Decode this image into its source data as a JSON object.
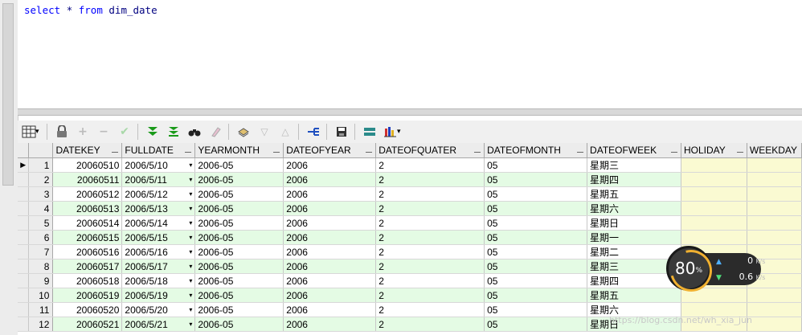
{
  "editor": {
    "sql_keyword_select": "select",
    "sql_star": "*",
    "sql_keyword_from": "from",
    "sql_table": "dim_date"
  },
  "toolbar": {
    "icons": [
      "grid-view-icon",
      "lock-icon",
      "add-record-icon",
      "delete-record-icon",
      "post-changes-icon",
      "fetch-next-icon",
      "fetch-last-icon",
      "query-by-example-icon",
      "clear-icon",
      "export-icon",
      "sort-desc-icon",
      "sort-asc-icon",
      "explain-plan-icon",
      "save-icon",
      "bind-variables-icon",
      "chart-icon"
    ]
  },
  "grid": {
    "columns": [
      "DATEKEY",
      "FULLDATE",
      "YEARMONTH",
      "DATEOFYEAR",
      "DATEOFQUATER",
      "DATEOFMONTH",
      "DATEOFWEEK",
      "HOLIDAY",
      "WEEKDAY"
    ],
    "rows": [
      {
        "n": "1",
        "datekey": "20060510",
        "fulldate": "2006/5/10",
        "yearmonth": "2006-05",
        "dateofyear": "2006",
        "quater": "2",
        "month": "05",
        "week": "星期三"
      },
      {
        "n": "2",
        "datekey": "20060511",
        "fulldate": "2006/5/11",
        "yearmonth": "2006-05",
        "dateofyear": "2006",
        "quater": "2",
        "month": "05",
        "week": "星期四"
      },
      {
        "n": "3",
        "datekey": "20060512",
        "fulldate": "2006/5/12",
        "yearmonth": "2006-05",
        "dateofyear": "2006",
        "quater": "2",
        "month": "05",
        "week": "星期五"
      },
      {
        "n": "4",
        "datekey": "20060513",
        "fulldate": "2006/5/13",
        "yearmonth": "2006-05",
        "dateofyear": "2006",
        "quater": "2",
        "month": "05",
        "week": "星期六"
      },
      {
        "n": "5",
        "datekey": "20060514",
        "fulldate": "2006/5/14",
        "yearmonth": "2006-05",
        "dateofyear": "2006",
        "quater": "2",
        "month": "05",
        "week": "星期日"
      },
      {
        "n": "6",
        "datekey": "20060515",
        "fulldate": "2006/5/15",
        "yearmonth": "2006-05",
        "dateofyear": "2006",
        "quater": "2",
        "month": "05",
        "week": "星期一"
      },
      {
        "n": "7",
        "datekey": "20060516",
        "fulldate": "2006/5/16",
        "yearmonth": "2006-05",
        "dateofyear": "2006",
        "quater": "2",
        "month": "05",
        "week": "星期二"
      },
      {
        "n": "8",
        "datekey": "20060517",
        "fulldate": "2006/5/17",
        "yearmonth": "2006-05",
        "dateofyear": "2006",
        "quater": "2",
        "month": "05",
        "week": "星期三"
      },
      {
        "n": "9",
        "datekey": "20060518",
        "fulldate": "2006/5/18",
        "yearmonth": "2006-05",
        "dateofyear": "2006",
        "quater": "2",
        "month": "05",
        "week": "星期四"
      },
      {
        "n": "10",
        "datekey": "20060519",
        "fulldate": "2006/5/19",
        "yearmonth": "2006-05",
        "dateofyear": "2006",
        "quater": "2",
        "month": "05",
        "week": "星期五"
      },
      {
        "n": "11",
        "datekey": "20060520",
        "fulldate": "2006/5/20",
        "yearmonth": "2006-05",
        "dateofyear": "2006",
        "quater": "2",
        "month": "05",
        "week": "星期六"
      },
      {
        "n": "12",
        "datekey": "20060521",
        "fulldate": "2006/5/21",
        "yearmonth": "2006-05",
        "dateofyear": "2006",
        "quater": "2",
        "month": "05",
        "week": "星期日"
      }
    ]
  },
  "widget": {
    "percent": "80",
    "percent_sign": "%",
    "upload_value": "0",
    "upload_unit": "K/s",
    "download_value": "0.6",
    "download_unit": "K/s"
  },
  "watermark": "https://blog.csdn.net/wh_xia_jun",
  "colors": {
    "row_alt": "#e4fbe4",
    "null_cell": "#fafad2",
    "keyword": "#0000ff"
  }
}
